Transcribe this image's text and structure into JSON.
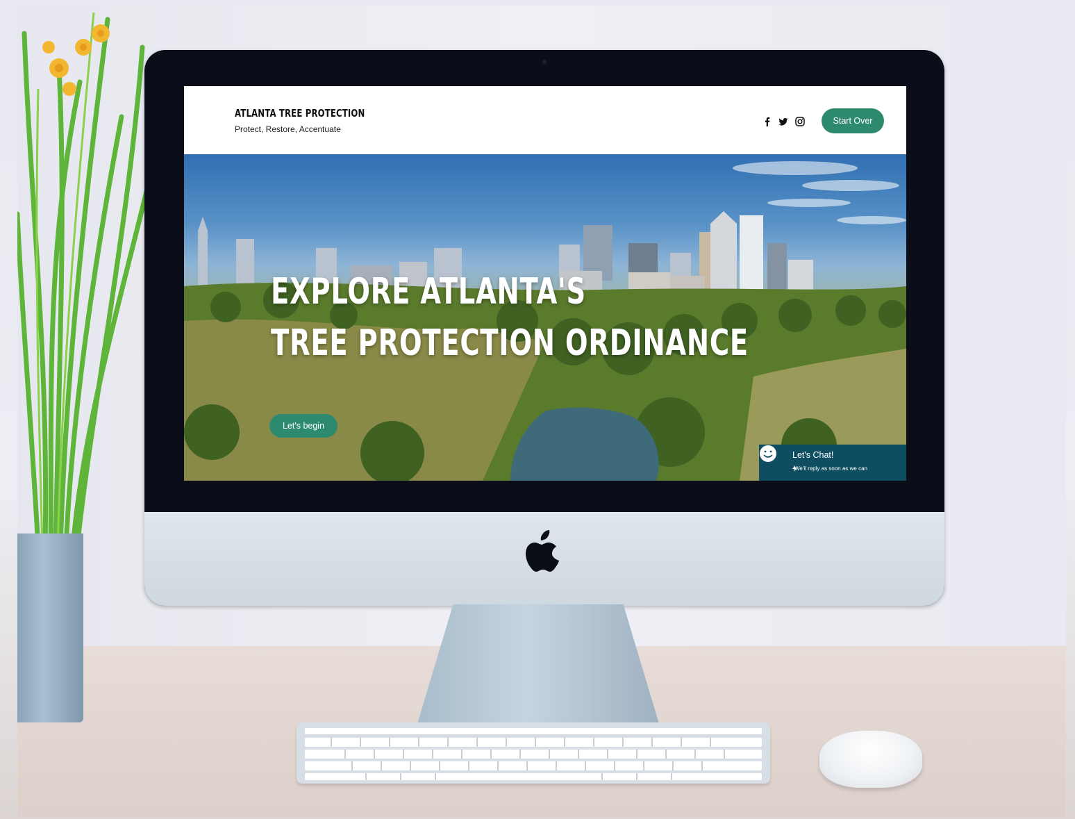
{
  "site": {
    "brand_title": "ATLANTA TREE PROTECTION",
    "brand_tagline": "Protect, Restore, Accentuate",
    "start_over_label": "Start Over"
  },
  "social_icons": [
    "facebook-icon",
    "twitter-icon",
    "instagram-icon"
  ],
  "hero": {
    "line1": "EXPLORE ATLANTA'S",
    "line2": "TREE PROTECTION ORDINANCE",
    "cta_label": "Let's begin"
  },
  "chat": {
    "title": "Let's Chat!",
    "subtitle": "We'll reply as soon as we can"
  },
  "colors": {
    "accent": "#2e8a6e",
    "chat_bg": "#0f4e61"
  }
}
